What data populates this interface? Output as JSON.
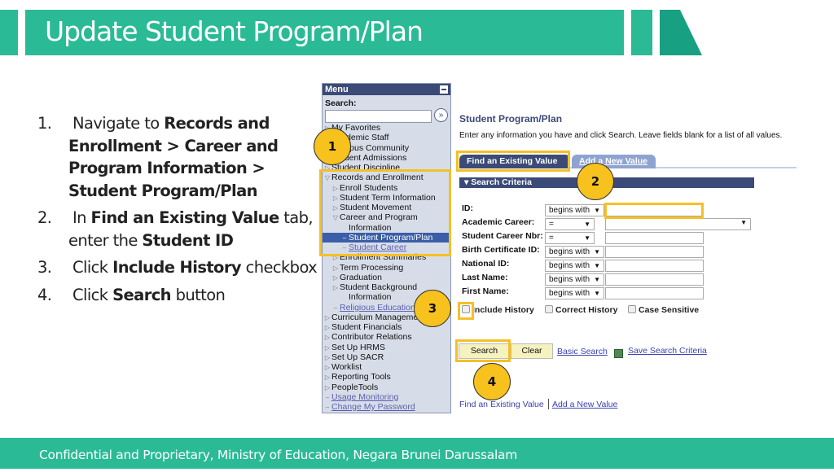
{
  "slide": {
    "title": "Update Student Program/Plan",
    "footer": "Confidential and Proprietary, Ministry of Education, Negara Brunei Darussalam",
    "accent": "#2bba96",
    "steps": [
      {
        "num": "1.",
        "parts": [
          {
            "t": "Navigate to ",
            "b": false
          },
          {
            "t": "Records and Enrollment > Career and Program Information > Student Program/Plan",
            "b": true
          }
        ]
      },
      {
        "num": "2.",
        "parts": [
          {
            "t": "In ",
            "b": false
          },
          {
            "t": "Find an Existing Value",
            "b": true
          },
          {
            "t": " tab, enter the ",
            "b": false
          },
          {
            "t": "Student ID",
            "b": true
          }
        ]
      },
      {
        "num": "3.",
        "parts": [
          {
            "t": "Click ",
            "b": false
          },
          {
            "t": "Include History",
            "b": true
          },
          {
            "t": " checkbox",
            "b": false
          }
        ]
      },
      {
        "num": "4.",
        "parts": [
          {
            "t": "Click ",
            "b": false
          },
          {
            "t": "Search",
            "b": true
          },
          {
            "t": " button",
            "b": false
          }
        ]
      }
    ],
    "badges": [
      "1",
      "2",
      "3",
      "4"
    ]
  },
  "menu": {
    "title": "Menu",
    "search_label": "Search:",
    "search_value": "",
    "items": [
      {
        "label": "My Favorites",
        "level": 0,
        "icon": "triangle-right"
      },
      {
        "label": "Academic Staff",
        "level": 0,
        "icon": "triangle-right"
      },
      {
        "label": "Campus Community",
        "level": 0,
        "icon": "triangle-right"
      },
      {
        "label": "Student Admissions",
        "level": 0,
        "icon": "triangle-right"
      },
      {
        "label": "Student Discipline",
        "level": 0,
        "icon": "triangle-right"
      },
      {
        "label": "Records and Enrollment",
        "level": 0,
        "icon": "triangle-down"
      },
      {
        "label": "Enroll Students",
        "level": 1,
        "icon": "triangle-right"
      },
      {
        "label": "Student Term Information",
        "level": 1,
        "icon": "triangle-right"
      },
      {
        "label": "Student Movement",
        "level": 1,
        "icon": "triangle-right"
      },
      {
        "label": "Career and Program",
        "level": 1,
        "icon": "triangle-down"
      },
      {
        "label": "Information",
        "level": 1,
        "icon": "cont"
      },
      {
        "label": "Student Program/Plan",
        "level": 2,
        "icon": "dash",
        "selected": true
      },
      {
        "label": "Student Career",
        "level": 2,
        "icon": "dash",
        "link": true
      },
      {
        "label": "Enrollment Summaries",
        "level": 1,
        "icon": "triangle-right"
      },
      {
        "label": "Term Processing",
        "level": 1,
        "icon": "triangle-right"
      },
      {
        "label": "Graduation",
        "level": 1,
        "icon": "triangle-right"
      },
      {
        "label": "Student Background",
        "level": 1,
        "icon": "triangle-right"
      },
      {
        "label": "Information",
        "level": 1,
        "icon": "cont"
      },
      {
        "label": "Religious Education",
        "level": 1,
        "icon": "dash",
        "link": true
      },
      {
        "label": "Curriculum Management",
        "level": 0,
        "icon": "triangle-right"
      },
      {
        "label": "Student Financials",
        "level": 0,
        "icon": "triangle-right"
      },
      {
        "label": "Contributor Relations",
        "level": 0,
        "icon": "triangle-right"
      },
      {
        "label": "Set Up HRMS",
        "level": 0,
        "icon": "triangle-right"
      },
      {
        "label": "Set Up SACR",
        "level": 0,
        "icon": "triangle-right"
      },
      {
        "label": "Worklist",
        "level": 0,
        "icon": "triangle-right"
      },
      {
        "label": "Reporting Tools",
        "level": 0,
        "icon": "triangle-right"
      },
      {
        "label": "PeopleTools",
        "level": 0,
        "icon": "triangle-right"
      },
      {
        "label": "Usage Monitoring",
        "level": 0,
        "icon": "dash",
        "link": true
      },
      {
        "label": "Change My Password",
        "level": 0,
        "icon": "dash",
        "link": true
      }
    ]
  },
  "page": {
    "title": "Student Program/Plan",
    "instructions": "Enter any information you have and click Search. Leave fields blank for a list of all values.",
    "tabs": [
      "Find an Existing Value",
      "Add a New Value"
    ],
    "section": "Search Criteria",
    "fields": [
      {
        "label": "ID:",
        "op": "begins with",
        "value": ""
      },
      {
        "label": "Academic Career:",
        "op": "=",
        "value": ""
      },
      {
        "label": "Student Career Nbr:",
        "op": "=",
        "value": ""
      },
      {
        "label": "Birth Certificate ID:",
        "op": "begins with",
        "value": ""
      },
      {
        "label": "National ID:",
        "op": "begins with",
        "value": ""
      },
      {
        "label": "Last Name:",
        "op": "begins with",
        "value": ""
      },
      {
        "label": "First Name:",
        "op": "begins with",
        "value": ""
      }
    ],
    "checkboxes": [
      {
        "label": "Include History",
        "checked": false
      },
      {
        "label": "Correct History",
        "checked": false
      },
      {
        "label": "Case Sensitive",
        "checked": false
      }
    ],
    "buttons": {
      "search": "Search",
      "clear": "Clear"
    },
    "links": {
      "basic_search": "Basic Search",
      "save_criteria": "Save Search Criteria",
      "find_existing": "Find an Existing Value",
      "add_new": "Add a New Value"
    }
  }
}
